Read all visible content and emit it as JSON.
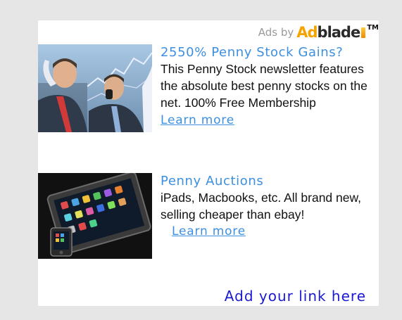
{
  "branding": {
    "ads_by_label": "Ads by",
    "logo_ad": "Ad",
    "logo_blade": "blade",
    "logo_tm": "TM",
    "colors": {
      "ad": "#f5a300",
      "blade": "#2a2a2a"
    }
  },
  "ads": [
    {
      "image_icon": "businessmen-phone-stock-chart-photo",
      "title": "2550% Penny Stock Gains?",
      "description": "This Penny Stock newsletter features the absolute best penny stocks on the net. 100% Free Membership",
      "learn_more": "Learn more"
    },
    {
      "image_icon": "tablet-and-phone-photo",
      "title": "Penny Auctions",
      "description": "iPads, Macbooks, etc. All brand new, selling cheaper than ebay!",
      "learn_more": "Learn more"
    }
  ],
  "footer": {
    "add_link": "Add your link here"
  },
  "colors": {
    "background": "#e6e6e6",
    "panel": "#ffffff",
    "ad_title": "#3d8fe0",
    "add_link": "#1a1ad2",
    "text": "#111111"
  }
}
